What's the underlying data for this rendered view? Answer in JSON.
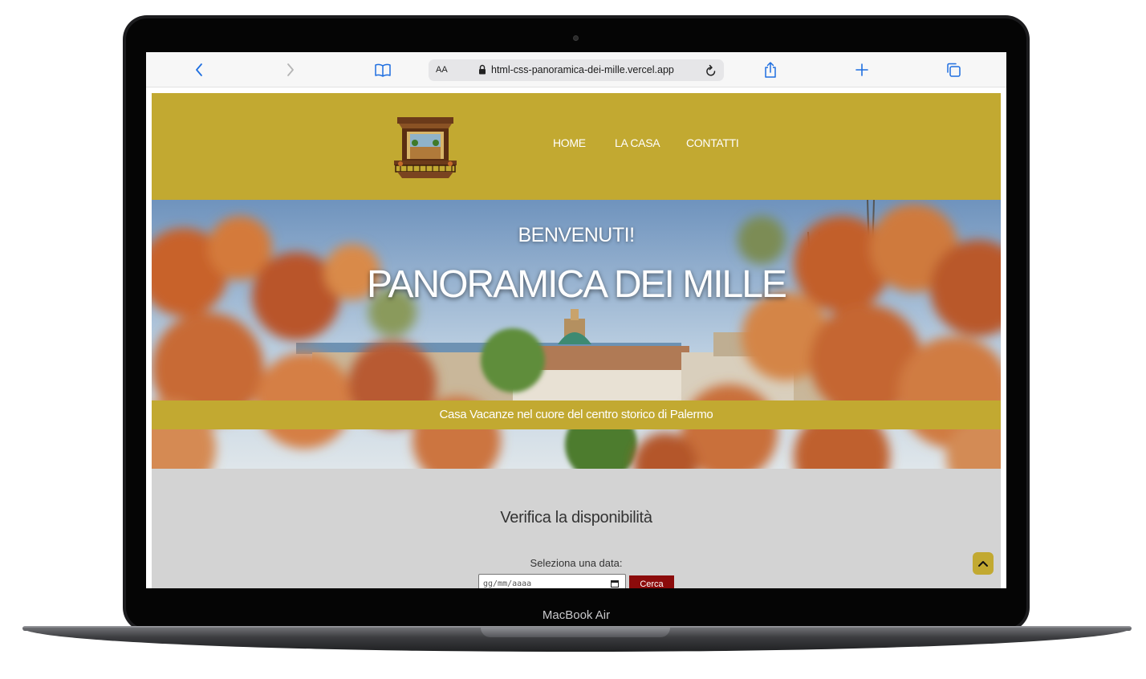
{
  "device": {
    "label": "MacBook Air"
  },
  "browser": {
    "text_size_label": "AA",
    "url": "html-css-panoramica-dei-mille.vercel.app"
  },
  "site": {
    "nav": [
      "HOME",
      "LA CASA",
      "CONTATTI"
    ],
    "hero": {
      "welcome": "BENVENUTI!",
      "title": "PANORAMICA DEI MILLE",
      "banner": "Casa Vacanze nel cuore del centro storico di Palermo"
    },
    "availability": {
      "title": "Verifica la disponibilità",
      "date_label": "Seleziona una data:",
      "date_placeholder": "gg/mm/aaaa",
      "search_label": "Cerca"
    }
  },
  "colors": {
    "header_gold": "#c2a931",
    "search_button": "#8b0b0b",
    "page_background": "#d3d3d3"
  }
}
